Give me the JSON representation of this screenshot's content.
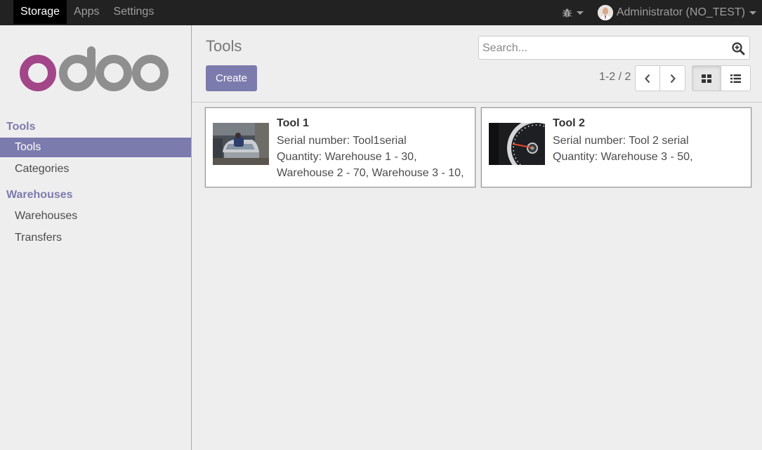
{
  "topbar": {
    "menu": [
      "Storage",
      "Apps",
      "Settings"
    ],
    "active_menu": "Storage",
    "debug_icon": "bug-icon",
    "user_name": "Administrator (NO_TEST)"
  },
  "sidebar": {
    "logo_text": "odoo",
    "sections": [
      {
        "title": "Tools",
        "items": [
          "Tools",
          "Categories"
        ]
      },
      {
        "title": "Warehouses",
        "items": [
          "Warehouses",
          "Transfers"
        ]
      }
    ],
    "active_item": "Tools"
  },
  "control_panel": {
    "title": "Tools",
    "search_placeholder": "Search...",
    "create_label": "Create",
    "pager": "1-2 / 2",
    "active_view": "kanban"
  },
  "records": [
    {
      "name": "Tool 1",
      "serial": "Serial number: Tool1serial",
      "quantity_lines": [
        "Quantity: Warehouse 1 - 30,",
        "Warehouse 2 - 70, Warehouse 3 - 10,"
      ]
    },
    {
      "name": "Tool 2",
      "serial": "Serial number: Tool 2 serial",
      "quantity_lines": [
        "Quantity: Warehouse 3 - 50,"
      ]
    }
  ],
  "colors": {
    "brand": "#7c7bad",
    "navbar": "#222222",
    "logo_o": "#a24689",
    "logo_gray": "#8f8f8f"
  }
}
